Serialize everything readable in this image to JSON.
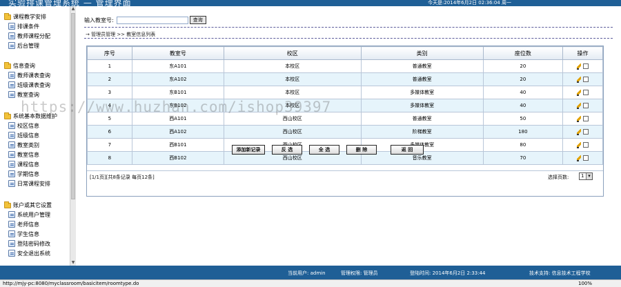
{
  "header": {
    "title": "实验排课管理系统 — 管理界面",
    "datetime": "今天是:2014年6月2日  02:36:04  周一"
  },
  "sidebar": {
    "groups": [
      {
        "label": "课程教学安排",
        "items": [
          "排课条件",
          "教师课程分配",
          "后台管理"
        ]
      },
      {
        "label": "信息查询",
        "items": [
          "教师课表查询",
          "班级课表查询",
          "教室查询"
        ]
      },
      {
        "label": "系统基本数据维护",
        "items": [
          "校区信息",
          "班级信息",
          "教室类别",
          "教室信息",
          "课程信息",
          "学期信息",
          "日常课程安排"
        ]
      },
      {
        "label": "账户或其它设置",
        "items": [
          "系统用户管理",
          "老师信息",
          "学生信息",
          "登陆密码修改",
          "安全退出系统"
        ]
      }
    ]
  },
  "search": {
    "label": "输入教室号:",
    "value": "",
    "button": "查询"
  },
  "breadcrumb": "→ 管理员管理 >> 教室信息列表",
  "table": {
    "headers": [
      "序号",
      "教室号",
      "校区",
      "类别",
      "座位数",
      "操作"
    ],
    "rows": [
      [
        "1",
        "东A101",
        "本校区",
        "普通教室",
        "20"
      ],
      [
        "2",
        "东A102",
        "本校区",
        "普通教室",
        "20"
      ],
      [
        "3",
        "东B101",
        "本校区",
        "多媒体教室",
        "40"
      ],
      [
        "4",
        "东B102",
        "本校区",
        "多媒体教室",
        "40"
      ],
      [
        "5",
        "西A101",
        "西山校区",
        "普通教室",
        "50"
      ],
      [
        "6",
        "西A102",
        "西山校区",
        "阶梯教室",
        "180"
      ],
      [
        "7",
        "西B101",
        "西山校区",
        "多媒体教室",
        "80"
      ],
      [
        "8",
        "西B102",
        "西山校区",
        "音乐教室",
        "70"
      ]
    ]
  },
  "pager": {
    "info": "[1/1页][共8条记录 每页12条]",
    "select_label": "选择页数:",
    "page": "1"
  },
  "buttons": {
    "add": "添加新记录",
    "invert": "反 选",
    "all": "全 选",
    "delete": "删 除",
    "back": "返 回"
  },
  "watermark": "https://www.huzhan.com/ishop39397",
  "footer": {
    "user": "当前用户: admin",
    "role": "管理权限: 管理员",
    "login": "登陆时间: 2014年6月2日 2:33:44",
    "support": "技术支持: 信息技术工程学校"
  },
  "statusbar": {
    "url": "http://mjy-pc:8080/myclassroom/basicitem/roomtype.do",
    "zoom": "100%"
  },
  "colors": {
    "header_bg": "#1f5f96",
    "row_alt": "#e6f4fb"
  }
}
